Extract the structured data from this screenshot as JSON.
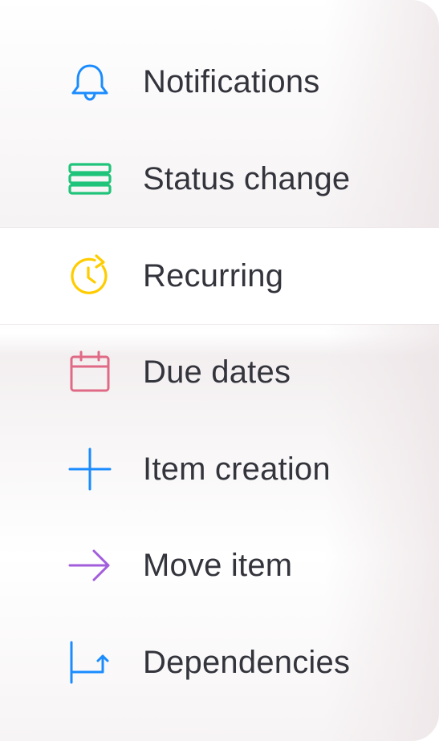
{
  "menu": {
    "items": [
      {
        "label": "Notifications",
        "icon": "bell-icon",
        "color": "#1a8cff"
      },
      {
        "label": "Status change",
        "icon": "stack-icon",
        "color": "#1fc47a"
      },
      {
        "label": "Recurring",
        "icon": "clock-refresh-icon",
        "color": "#ffcc00"
      },
      {
        "label": "Due dates",
        "icon": "calendar-icon",
        "color": "#e06a85"
      },
      {
        "label": "Item creation",
        "icon": "plus-icon",
        "color": "#1a8cff"
      },
      {
        "label": "Move item",
        "icon": "arrow-right-icon",
        "color": "#a25ddc"
      },
      {
        "label": "Dependencies",
        "icon": "dependency-icon",
        "color": "#1a8cff"
      }
    ],
    "selected_index": 2
  }
}
